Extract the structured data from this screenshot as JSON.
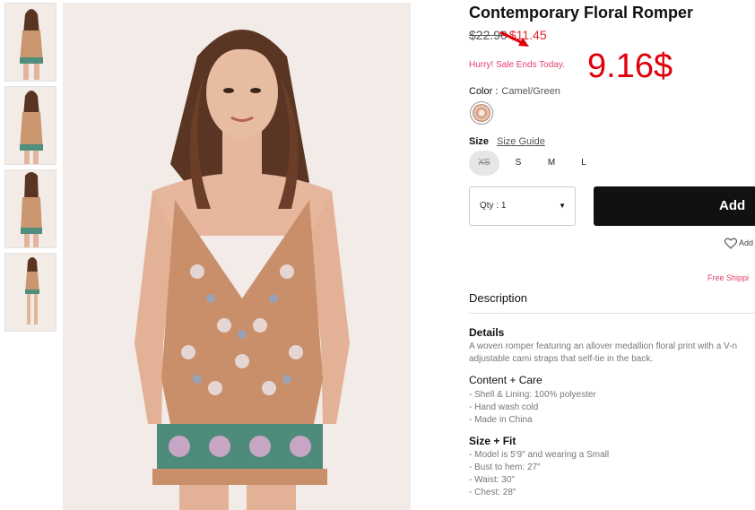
{
  "product": {
    "title": "Contemporary Floral Romper",
    "old_price": "$22.90",
    "sale_price": "$11.45",
    "hurry": "Hurry! Sale Ends Today.",
    "annotation": "9.16$"
  },
  "color": {
    "label": "Color :",
    "value": "Camel/Green"
  },
  "size": {
    "label": "Size",
    "guide": "Size Guide",
    "options": [
      "XS",
      "S",
      "M",
      "L"
    ]
  },
  "cart": {
    "qty": "Qty : 1",
    "add_label": "Add",
    "wishlist": "Add"
  },
  "free_shipping": "Free Shippi",
  "description": {
    "title": "Description",
    "details_title": "Details",
    "details_lines": [
      "A woven romper featuring an allover medallion floral print with a V-n",
      "adjustable cami straps that self-tie in the back."
    ],
    "care_title": "Content + Care",
    "care_lines": [
      "- Shell & Lining: 100% polyester",
      "- Hand wash cold",
      "- Made in China"
    ],
    "fit_title": "Size + Fit",
    "fit_lines": [
      "- Model is 5'9\" and wearing a Small",
      "- Bust to hem: 27\"",
      "- Waist: 30\"",
      "- Chest: 28\""
    ]
  },
  "icons": {
    "arrow": "red-arrow-icon",
    "heart": "heart-icon",
    "caret": "caret-down-icon"
  },
  "colors": {
    "sale": "#e0262c",
    "annotation": "#e0000a",
    "accent": "#e4406a"
  }
}
